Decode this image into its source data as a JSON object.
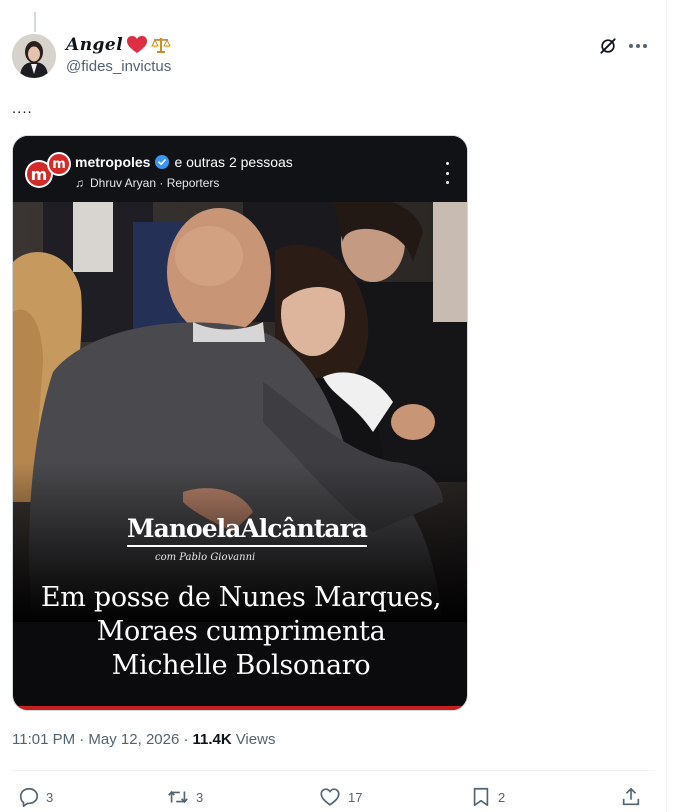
{
  "author": {
    "display_name": "𝑨𝒏𝒈𝒆𝒍",
    "handle": "@fides_invictus"
  },
  "tweet": {
    "text": "....",
    "timestamp": "11:01 PM · May 12, 2026",
    "views_count": "11.4K",
    "views_label": "Views"
  },
  "media": {
    "account": "metropoles",
    "others": "e outras 2 pessoas",
    "audio": "Dhruv Aryan · Reporters",
    "logo_letter": "m",
    "brand": "ManoelaAlcântara",
    "brand_sub": "com Pablo Giovanni",
    "headline_lines": [
      "Em posse de Nunes Marques,",
      "Moraes cumprimenta",
      "Michelle Bolsonaro"
    ]
  },
  "actions": {
    "replies": "3",
    "reposts": "3",
    "likes": "17",
    "bookmarks": "2"
  },
  "icons": {
    "heart": "heart-emoji",
    "scales": "scales-emoji",
    "grok": "grok-icon",
    "more": "more-icon"
  },
  "colors": {
    "text_primary": "#0f1419",
    "text_secondary": "#536471",
    "border": "#eff3f4",
    "verified": "#3897f0",
    "brand_red": "#c71f1f"
  }
}
